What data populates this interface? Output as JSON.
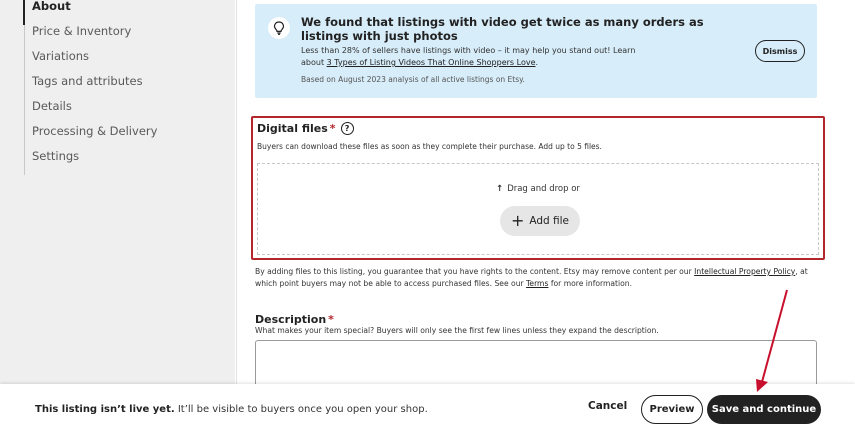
{
  "sidebar": {
    "items": [
      {
        "label": "About"
      },
      {
        "label": "Price & Inventory"
      },
      {
        "label": "Variations"
      },
      {
        "label": "Tags and attributes"
      },
      {
        "label": "Details"
      },
      {
        "label": "Processing & Delivery"
      },
      {
        "label": "Settings"
      }
    ]
  },
  "banner": {
    "icon": "lightbulb-icon",
    "title": "We found that listings with video get twice as many orders as listings with just photos",
    "text_before": "Less than 28% of sellers have listings with video – it may help you stand out! Learn about ",
    "link": "3 Types of Listing Videos That Online Shoppers Love",
    "text_after": ".",
    "note": "Based on August 2023 analysis of all active listings on Etsy.",
    "dismiss_label": "Dismiss",
    "bg_color": "#d7edf9"
  },
  "digital_files": {
    "label": "Digital files",
    "required_mark": "*",
    "help_icon": "?",
    "help_text": "Buyers can download these files as soon as they complete their purchase. Add up to 5 files.",
    "drag_text": "Drag and drop or",
    "add_file_label": "Add file",
    "highlight_color": "#b3262c"
  },
  "legal": {
    "text1": "By adding files to this listing, you guarantee that you have rights to the content. Etsy may remove content per our ",
    "link1": "Intellectual Property Policy",
    "text2": ", at which point buyers may not be able to access purchased files. See our ",
    "link2": "Terms",
    "text3": " for more information."
  },
  "description": {
    "label": "Description",
    "required_mark": "*",
    "help_text": "What makes your item special? Buyers will only see the first few lines unless they expand the description.",
    "value": ""
  },
  "footer": {
    "status_bold": "This listing isn’t live yet.",
    "status_rest": " It’ll be visible to buyers once you open your shop.",
    "cancel_label": "Cancel",
    "preview_label": "Preview",
    "save_label": "Save and continue"
  },
  "annotation": {
    "arrow_color": "#c8102e"
  }
}
